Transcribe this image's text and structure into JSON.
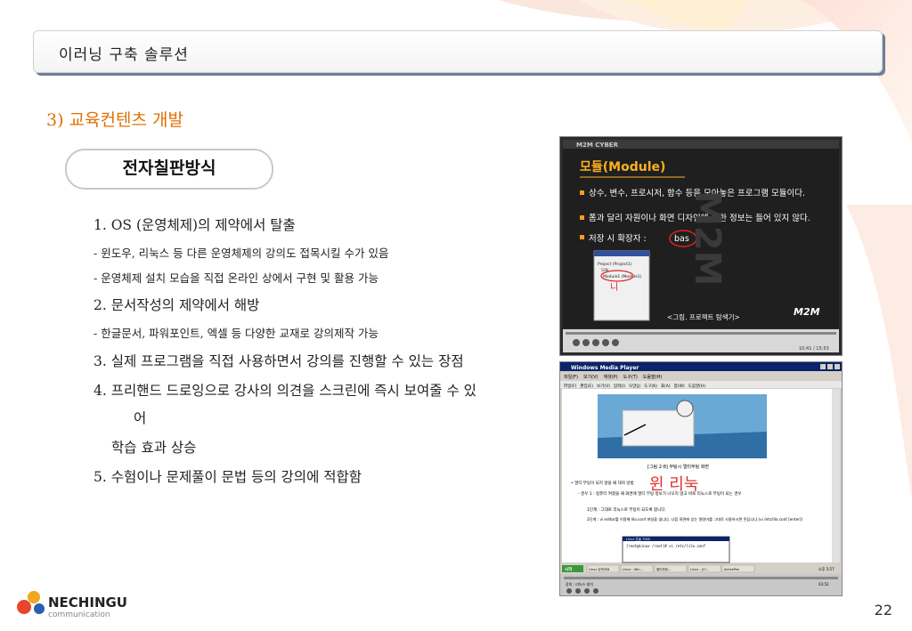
{
  "header": {
    "title": "이러닝 구축 솔루션"
  },
  "section": {
    "title": "3) 교육컨텐츠 개발"
  },
  "pill_label": "전자칠판방식",
  "body_lines": [
    "1. OS (운영체제)의 제약에서 탈출",
    "- 윈도우, 리눅스 등 다른 운영체제의 강의도 접목시킬 수가 있음",
    "- 운영체제 설치 모습을 직접 온라인 상에서 구현 및 활용 가능",
    "2. 문서작성의 제약에서 해방",
    "- 한글문서, 파워포인트, 엑셀 등 다양한 교재로 강의제작 가능",
    "3. 실제 프로그램을 직접 사용하면서 강의를 진행할 수 있는 장점",
    "4. 프리핸드 드로잉으로 강사의 의견을 스크린에 즉시 보여줄 수 있",
    "어",
    "학습 효과 상승",
    "5. 수험이나 문제풀이 문법 등의 강의에 적합함"
  ],
  "screenshot1": {
    "brand": "M2M CYBER",
    "slide_title": "모듈(Module)",
    "bullets": [
      "상수, 변수, 프로시저, 함수 등을 모아놓은 프로그램 모듈이다.",
      "폼과 달리 자원이나 화면 디자인에 관한 정보는 들어 있지 않다.",
      "저장 시 확장자 :"
    ],
    "extension": "bas",
    "caption": "<그림. 프로젝트 탐색기>",
    "watermark": "M2M",
    "tree": [
      "Project (Project1)",
      "모듈",
      "Module1 (Module1)"
    ],
    "annotation": "니",
    "time": "10:41 / 15:53"
  },
  "screenshot2": {
    "window_title": "Windows Media Player",
    "menu": [
      "파일(F)",
      "보기(V)",
      "재생(P)",
      "도구(T)",
      "도움말(H)"
    ],
    "inner_menu": [
      "파일(F)",
      "편집(E)",
      "보기(V)",
      "입력(I)",
      "모양(J)",
      "도구(K)",
      "표(A)",
      "창(W)",
      "도움말(H)"
    ],
    "figure_caption": "[그림 2-8] 부팅시 멀티부팅 화면",
    "handwriting": "윈 리눅",
    "doc_lines": [
      "• 멀티 부팅이 되지 않을 때 대처 방법",
      "- 경우 1 : 컴퓨터 켜졌을 때 화면에 멀티 부팅 정보가 나오지 않고 바로 리눅스로 부팅이 되는 경우",
      "1단계 : 그대로 리눅스로 부팅이 되도록 합니다.",
      "2단계 : vi editor를 이용해 lilo.conf 파일을 엽니다. 다음 화면에 있는 명령어를 그대로 사용하시면 된답니다.(vi /etc/lilo.conf [enter])"
    ],
    "terminal_title": "Linux 콘솔 7000",
    "terminal_cmd": "[root@Linux /root]# vi /etc/lilo.conf",
    "taskbar": [
      "시작",
      "Linux 강의자료",
      "Linux - Win...",
      "멀티부팅...",
      "Linux - [Cl...",
      "ActivePen"
    ],
    "clock": "오후 5:57",
    "status_left": "강의 : 리눅스 설치",
    "status_right": "03:52"
  },
  "logo": {
    "name": "NECHINGU",
    "sub": "communication"
  },
  "page_number": "22"
}
